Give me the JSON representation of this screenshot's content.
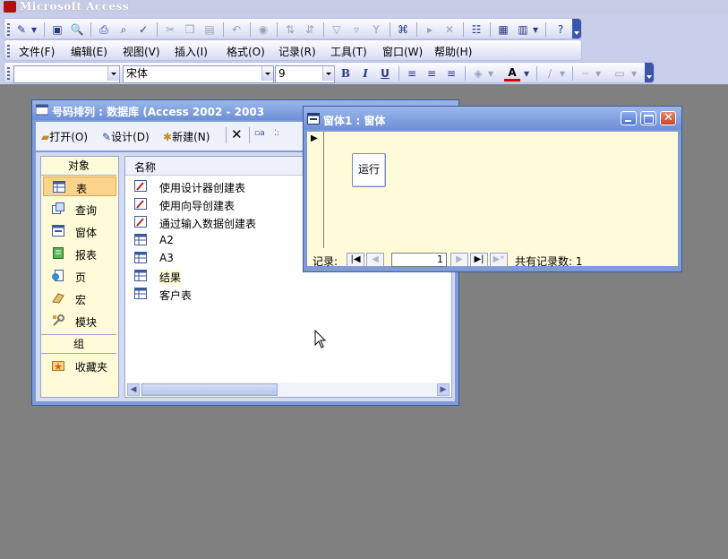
{
  "app": {
    "title": "Microsoft Access"
  },
  "menu": {
    "items": [
      "文件(F)",
      "编辑(E)",
      "视图(V)",
      "插入(I)",
      "格式(O)",
      "记录(R)",
      "工具(T)",
      "窗口(W)",
      "帮助(H)"
    ]
  },
  "format_toolbar": {
    "object_value": "",
    "font_value": "宋体",
    "size_value": "9",
    "bold": "B",
    "italic": "I",
    "underline": "U"
  },
  "db_window": {
    "title": "号码排列 : 数据库 (Access 2002 - 2003",
    "toolbar": {
      "open": "打开(O)",
      "design": "设计(D)",
      "new": "新建(N)"
    },
    "objects_header": "对象",
    "objects": [
      "表",
      "查询",
      "窗体",
      "报表",
      "页",
      "宏",
      "模块"
    ],
    "groups_header": "组",
    "favorites": "收藏夹",
    "list_header": "名称",
    "list_items": [
      "使用设计器创建表",
      "使用向导创建表",
      "通过输入数据创建表",
      "A2",
      "A3",
      "结果",
      "客户表"
    ]
  },
  "form_window": {
    "title": "窗体1 : 窗体",
    "run_button": "运行",
    "nav": {
      "label": "记录:",
      "current": "1",
      "total_label": "共有记录数: 1"
    }
  },
  "colors": {
    "app_background": "#808080",
    "toolbar_band": "#C9CEEB",
    "window_blue": "#7D9BD8",
    "form_background": "#FFFBD8",
    "selected_object": "#FBD38B",
    "close_button": "#C8452E"
  }
}
